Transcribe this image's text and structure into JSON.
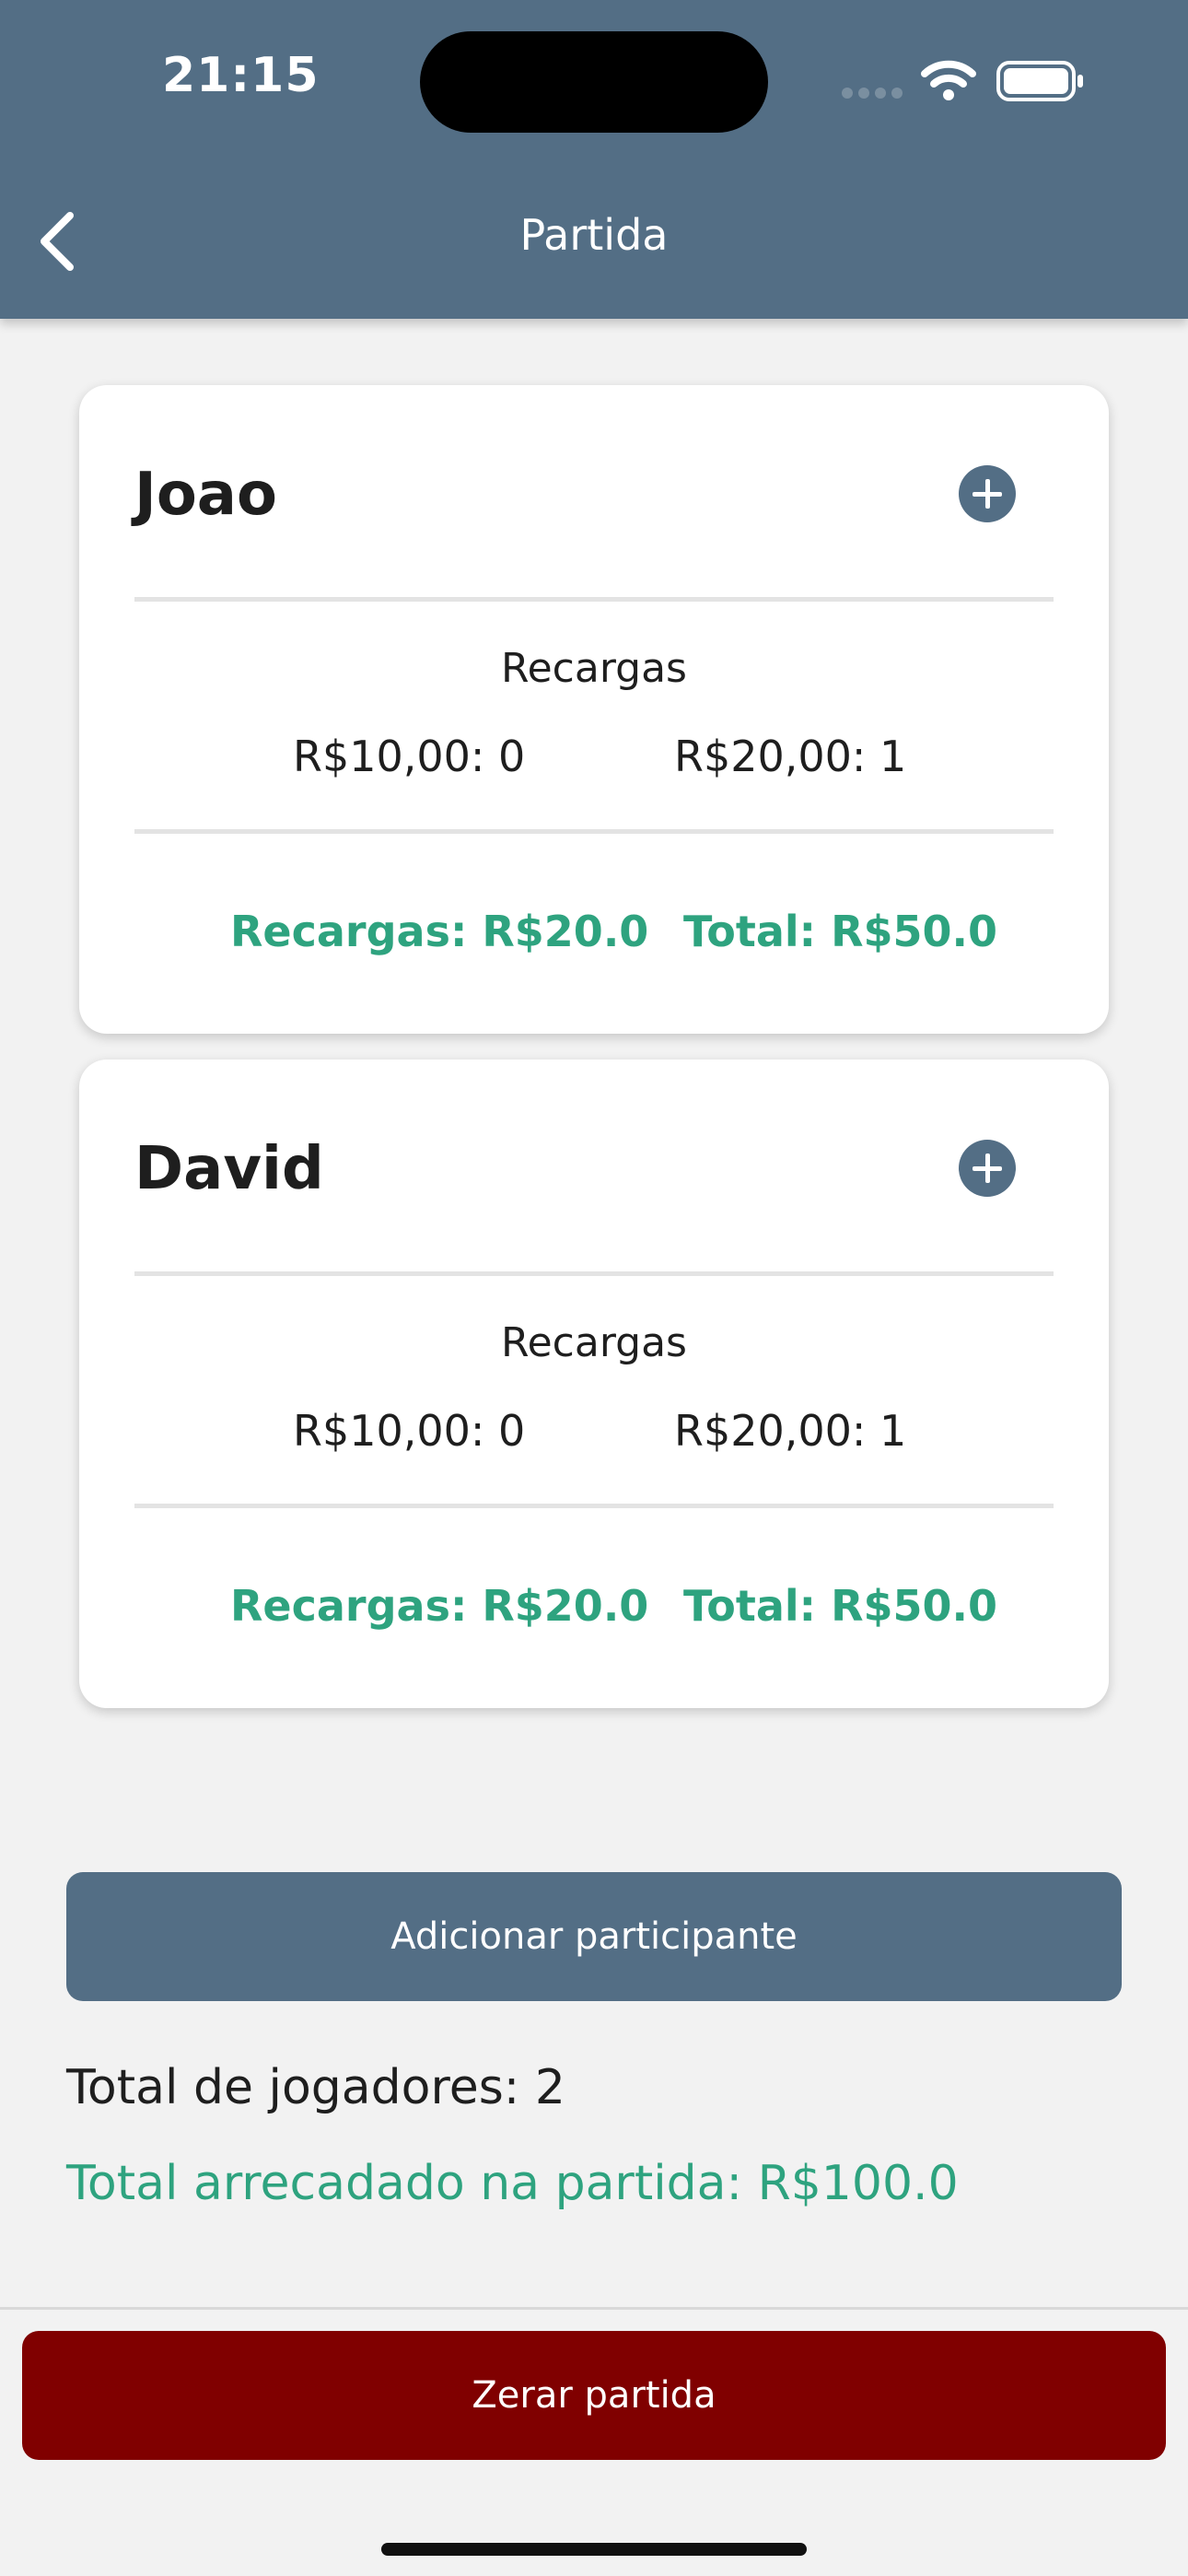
{
  "status_bar": {
    "time": "21:15"
  },
  "header": {
    "title": "Partida",
    "back_icon": "chevron-left-icon"
  },
  "players": [
    {
      "name": "Joao",
      "recargas_title": "Recargas",
      "recarga_10": "R$10,00: 0",
      "recarga_20": "R$20,00: 1",
      "recargas_sum": "Recargas: R$20.0",
      "total": "Total: R$50.0"
    },
    {
      "name": "David",
      "recargas_title": "Recargas",
      "recarga_10": "R$10,00: 0",
      "recarga_20": "R$20,00: 1",
      "recargas_sum": "Recargas: R$20.0",
      "total": "Total: R$50.0"
    }
  ],
  "actions": {
    "add_participant": "Adicionar participante",
    "reset_match": "Zerar partida"
  },
  "summary": {
    "total_players": "Total de jogadores: 2",
    "total_collected": "Total arrecadado na partida: R$100.0"
  },
  "colors": {
    "header": "#536e85",
    "accent_green": "#2ea37f",
    "danger": "#800000"
  }
}
